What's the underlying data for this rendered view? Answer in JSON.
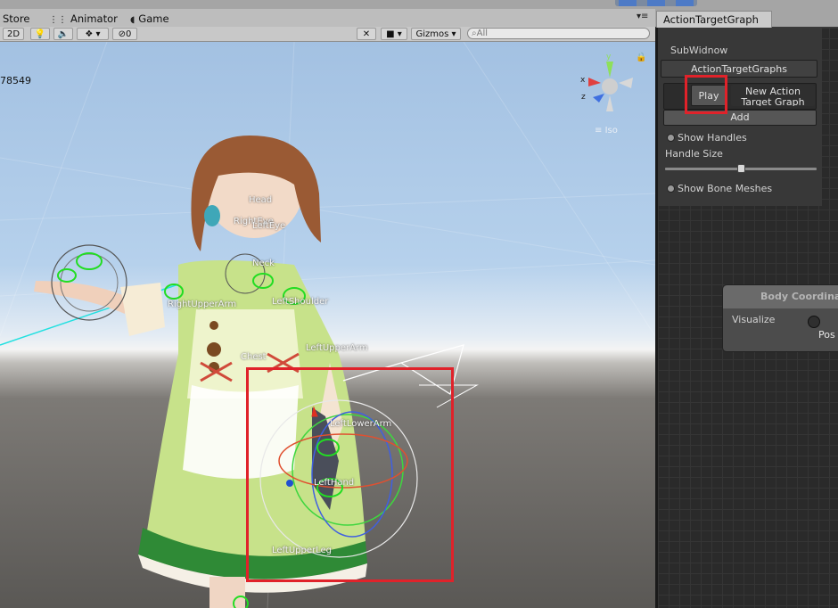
{
  "tabs": {
    "store": "Store",
    "animator": "Animator",
    "game": "Game",
    "right_window": "ActionTargetGraph"
  },
  "toolbar": {
    "mode_2d": "2D",
    "fx_count": "0",
    "gizmos": "Gizmos",
    "search_placeholder": "All"
  },
  "scene": {
    "coordinate_readout": "78549",
    "projection_label": "Iso",
    "gizmo_axes": [
      "x",
      "y",
      "z"
    ],
    "bone_labels": [
      "Head",
      "RightEye",
      "LeftEye",
      "Neck",
      "RightUpperArm",
      "LeftShoulder",
      "LeftUpperArm",
      "Chest",
      "LeftLowerArm",
      "LeftHand",
      "LeftUpperLeg"
    ]
  },
  "panel": {
    "subwindow_label": "SubWidnow",
    "dropdown_label": "ActionTargetGraphs",
    "play_button": "Play",
    "new_action_button": "New Action Target Graph",
    "add_button": "Add",
    "show_handles": "Show Handles",
    "handle_size_label": "Handle Size",
    "handle_size_value": 0.5,
    "show_bone_meshes": "Show Bone Meshes"
  },
  "node": {
    "title": "Body Coordinate",
    "row_label": "Visualize",
    "port_label": "Pos"
  },
  "colors": {
    "highlight": "#e0222a",
    "gizmo_green": "#22dd22"
  }
}
